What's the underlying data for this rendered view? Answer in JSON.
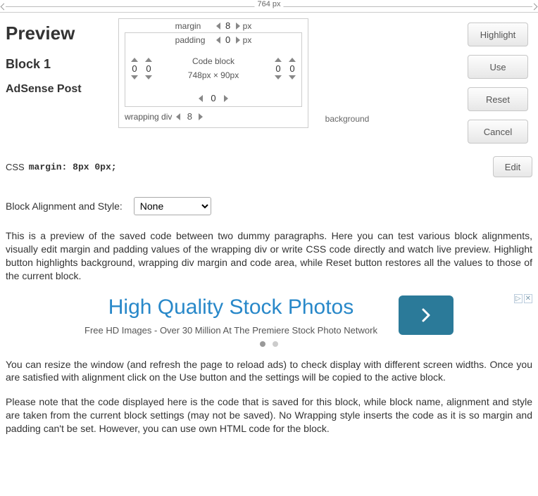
{
  "ruler": {
    "width_label": "764 px"
  },
  "header": {
    "preview": "Preview",
    "block": "Block 1",
    "name": "AdSense Post"
  },
  "buttons": {
    "highlight": "Highlight",
    "use": "Use",
    "reset": "Reset",
    "cancel": "Cancel",
    "edit": "Edit"
  },
  "boxmodel": {
    "margin_label": "margin",
    "margin_top": "8",
    "margin_unit": "px",
    "padding_label": "padding",
    "padding_top": "0",
    "padding_unit": "px",
    "margin_left": "0",
    "margin_right": "0",
    "padding_left": "0",
    "padding_right": "0",
    "padding_bottom": "0",
    "margin_bottom": "8",
    "wrapping_label": "wrapping div",
    "code_label": "Code block",
    "code_size": "748px × 90px",
    "background_label": "background"
  },
  "css": {
    "label": "CSS",
    "value": "margin: 8px 0px;"
  },
  "alignment": {
    "label": "Block Alignment and Style:",
    "selected": "None",
    "options": [
      "None"
    ]
  },
  "para1": "This is a preview of the saved code between two dummy paragraphs. Here you can test various block alignments, visually edit margin and padding values of the wrapping div or write CSS code directly and watch live preview. Highlight button highlights background, wrapping div margin and code area, while Reset button restores all the values to those of the current block.",
  "ad": {
    "headline": "High Quality Stock Photos",
    "sub": "Free HD Images - Over 30 Million At The Premiere Stock Photo Network"
  },
  "para2": "You can resize the window (and refresh the page to reload ads) to check display with different screen widths. Once you are satisfied with alignment click on the Use button and the settings will be copied to the active block.",
  "para3": "Please note that the code displayed here is the code that is saved for this block, while block name, alignment and style are taken from the current block settings (may not be saved). No Wrapping style inserts the code as it is so margin and padding can't be set. However, you can use own HTML code for the block."
}
